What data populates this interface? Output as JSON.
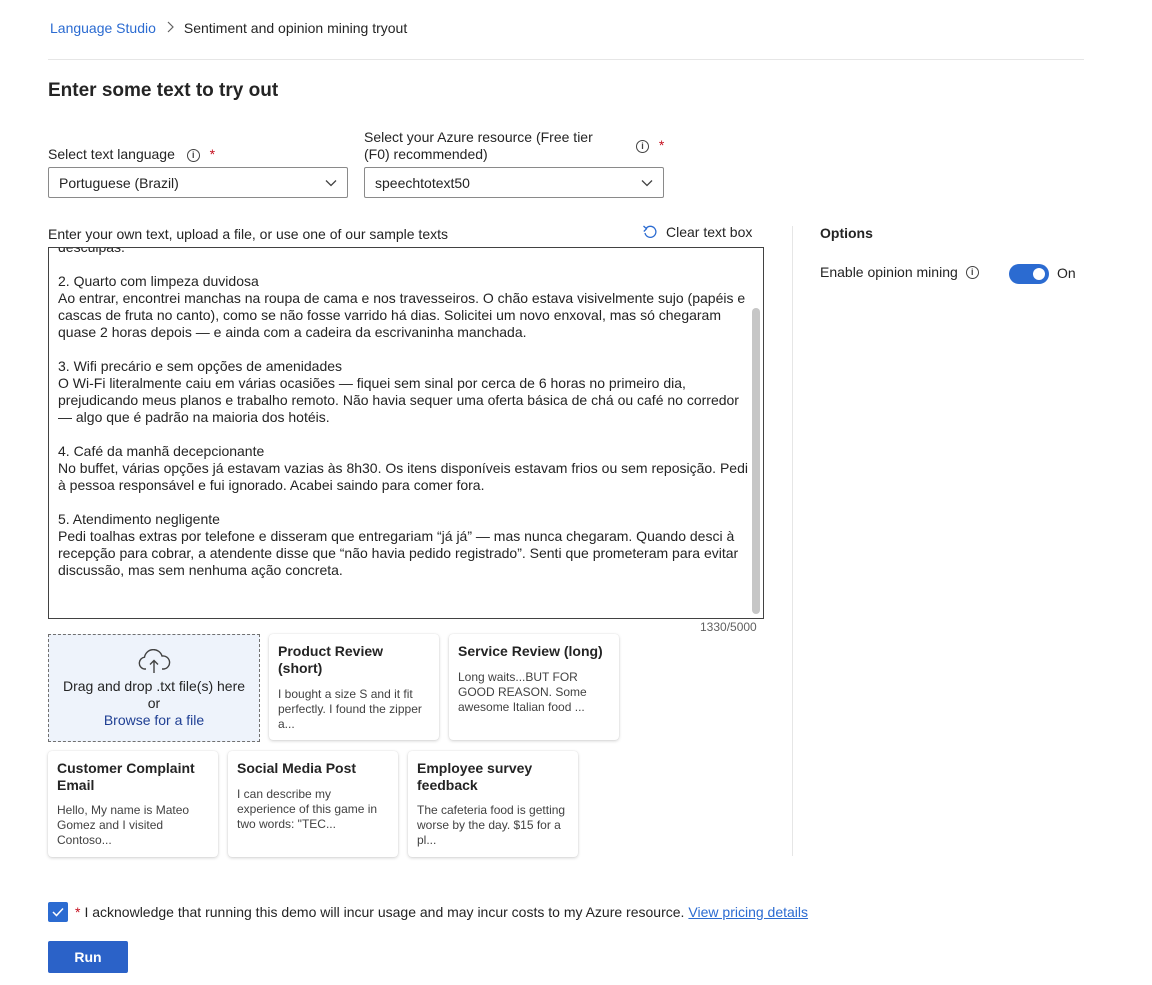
{
  "breadcrumb": {
    "root": "Language Studio",
    "current": "Sentiment and opinion mining tryout"
  },
  "page_title": "Enter some text to try out",
  "language": {
    "label": "Select text language",
    "value": "Portuguese (Brazil)"
  },
  "resource": {
    "label_line1": "Select your Azure resource (Free tier",
    "label_line2": "(F0) recommended)",
    "value": "speechtotext50"
  },
  "required_marker": "*",
  "info_glyph": "i",
  "textarea": {
    "label": "Enter your own text, upload a file, or use one of our sample texts",
    "clear_label": "Clear text box",
    "content": "desculpas.\n\n2. Quarto com limpeza duvidosa\nAo entrar, encontrei manchas na roupa de cama e nos travesseiros. O chão estava visivelmente sujo (papéis e cascas de fruta no canto), como se não fosse varrido há dias. Solicitei um novo enxoval, mas só chegaram quase 2 horas depois — e ainda com a cadeira da escrivaninha manchada.\n\n3. Wifi precário e sem opções de amenidades\nO Wi-Fi literalmente caiu em várias ocasiões — fiquei sem sinal por cerca de 6 horas no primeiro dia, prejudicando meus planos e trabalho remoto. Não havia sequer uma oferta básica de chá ou café no corredor — algo que é padrão na maioria dos hotéis.\n\n4. Café da manhã decepcionante\nNo buffet, várias opções já estavam vazias às 8h30. Os itens disponíveis estavam frios ou sem reposição. Pedi à pessoa responsável e fui ignorado. Acabei saindo para comer fora.\n\n5. Atendimento negligente\nPedi toalhas extras por telefone e disseram que entregariam “já já” — mas nunca chegaram. Quando desci à recepção para cobrar, a atendente disse que “não havia pedido registrado”. Senti que prometeram para evitar discussão, mas sem nenhuma ação concreta.",
    "counter": "1330/5000"
  },
  "dropzone": {
    "line1": "Drag and drop .txt file(s) here",
    "line2": "or",
    "browse": "Browse for a file"
  },
  "samples": [
    {
      "title": "Product Review (short)",
      "text": "I bought a size S and it fit perfectly. I found the zipper a..."
    },
    {
      "title": "Service Review (long)",
      "text": "Long waits...BUT FOR GOOD REASON. Some awesome Italian food ..."
    },
    {
      "title": "Customer Complaint Email",
      "text": "Hello, My name is Mateo Gomez and I visited Contoso..."
    },
    {
      "title": "Social Media Post",
      "text": "I can describe my experience of this game in two words: \"TEC..."
    },
    {
      "title": "Employee survey feedback",
      "text": "The cafeteria food is getting worse by the day. $15 for a pl..."
    }
  ],
  "options": {
    "title": "Options",
    "opinion_label": "Enable opinion mining",
    "toggle_state": "On"
  },
  "acknowledge": {
    "text": "I acknowledge that running this demo will incur usage and may incur costs to my Azure resource.",
    "link": "View pricing details"
  },
  "run_label": "Run",
  "colors": {
    "accent": "#2b6bd1",
    "required": "#c50f1f",
    "dropzone_bg": "#eef3fb"
  }
}
